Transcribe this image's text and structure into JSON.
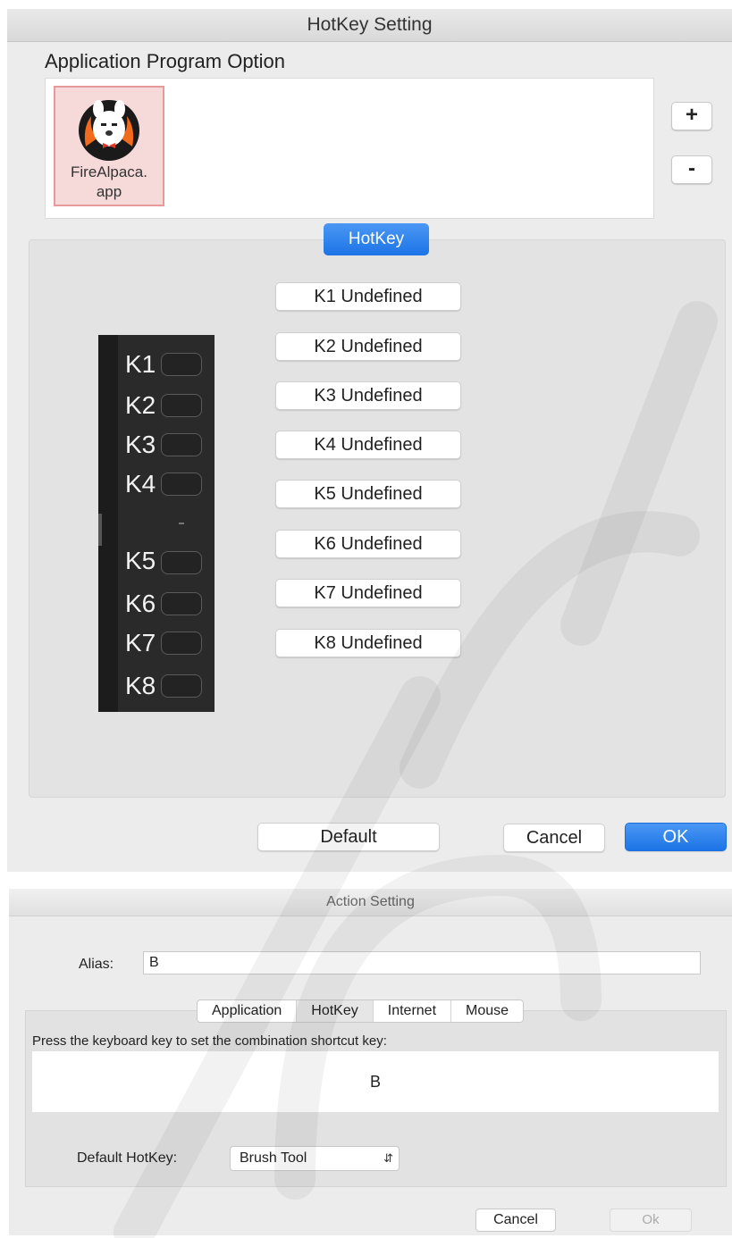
{
  "hotkey_window": {
    "title": "HotKey Setting",
    "app_section_label": "Application Program Option",
    "apps": [
      {
        "name_line1": "FireAlpaca.",
        "name_line2": "app",
        "icon": "fire-alpaca-icon"
      }
    ],
    "add_button": "+",
    "remove_button": "-",
    "tab_label": "HotKey",
    "tablet_keys": [
      "K1",
      "K2",
      "K3",
      "K4",
      "K5",
      "K6",
      "K7",
      "K8"
    ],
    "key_buttons": [
      "K1 Undefined",
      "K2 Undefined",
      "K3 Undefined",
      "K4 Undefined",
      "K5 Undefined",
      "K6 Undefined",
      "K7 Undefined",
      "K8 Undefined"
    ],
    "default_button": "Default",
    "cancel_button": "Cancel",
    "ok_button": "OK",
    "accent_color": "#1c74e6"
  },
  "action_window": {
    "title": "Action Setting",
    "alias_label": "Alias:",
    "alias_value": "B",
    "tabs": [
      "Application",
      "HotKey",
      "Internet",
      "Mouse"
    ],
    "active_tab": "HotKey",
    "instruction": "Press the keyboard key to set the combination shortcut key:",
    "shortcut_value": "B",
    "default_hotkey_label": "Default HotKey:",
    "default_hotkey_value": "Brush Tool",
    "cancel_button": "Cancel",
    "ok_button": "Ok"
  }
}
